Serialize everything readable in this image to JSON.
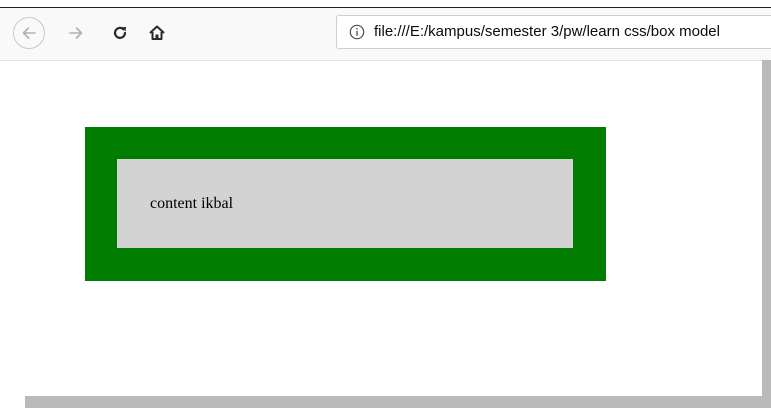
{
  "browser": {
    "address_bar": {
      "url": "file:///E:/kampus/semester 3/pw/learn css/box model"
    },
    "nav": {
      "back_icon": "arrow-left-icon",
      "forward_icon": "arrow-right-icon",
      "reload_icon": "reload-icon",
      "home_icon": "home-icon",
      "info_icon": "info-icon"
    }
  },
  "page": {
    "content_text": "content ikbal"
  },
  "colors": {
    "border_green": "#007c00",
    "content_gray": "#d3d3d3",
    "page_background": "#ffffff"
  }
}
